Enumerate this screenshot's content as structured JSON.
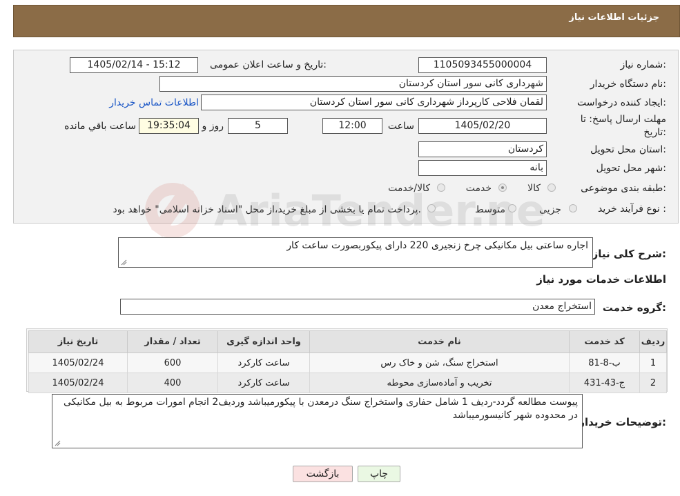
{
  "header": {
    "title": "جزئیات اطلاعات نیاز"
  },
  "form": {
    "need_number": {
      "label": "شماره نیاز:",
      "value": "1105093455000004"
    },
    "announce_datetime": {
      "label": "تاریخ و ساعت اعلان عمومی:",
      "value": "1405/02/14 - 15:12"
    },
    "buyer_org": {
      "label": "نام دستگاه خریدار:",
      "value": "شهرداری کانی سور استان کردستان"
    },
    "requester": {
      "label": "ایجاد کننده درخواست:",
      "value": "لقمان فلاحی کارپرداز شهرداری کانی سور استان کردستان"
    },
    "contact_link": "اطلاعات تماس خریدار",
    "deadline": {
      "label_line1": "مهلت ارسال پاسخ: تا",
      "label_line2": "تاریخ:",
      "date": "1405/02/20",
      "time_label": "ساعت",
      "time": "12:00",
      "days": "5",
      "days_label": "روز و",
      "remaining": "19:35:04",
      "remaining_label": "ساعت باقي مانده"
    },
    "province": {
      "label": "استان محل تحویل:",
      "value": "کردستان"
    },
    "city": {
      "label": "شهر محل تحویل:",
      "value": "بانه"
    },
    "category": {
      "label": "طبقه بندی موضوعی:",
      "options": [
        "کالا",
        "خدمت",
        "کالا/خدمت"
      ],
      "selected": "خدمت"
    },
    "purchase_type": {
      "label": "نوع فرآیند خرید :",
      "options": [
        "جزیی",
        "متوسط"
      ],
      "note": "پرداخت تمام یا بخشی از مبلغ خرید،از محل \"اسناد خزانه اسلامی\" خواهد بود."
    }
  },
  "watermark": "AriaTender.neT",
  "summary": {
    "label": "شرح کلی نیاز:",
    "value": "اجاره ساعتی بیل مکانیکی چرخ زنجیری 220 دارای پیکوربصورت ساعت کار"
  },
  "services_section": {
    "title": "اطلاعات خدمات مورد نیاز",
    "group_label": "گروه خدمت:",
    "group_value": "استخراج معدن"
  },
  "table": {
    "headers": [
      "ردیف",
      "کد خدمت",
      "نام خدمت",
      "واحد اندازه گیری",
      "تعداد / مقدار",
      "تاریخ نیاز"
    ],
    "rows": [
      [
        "1",
        "ب-8-81",
        "استخراج سنگ، شن و خاک رس",
        "ساعت کارکرد",
        "600",
        "1405/02/24"
      ],
      [
        "2",
        "ج-43-431",
        "تخریب و آماده‌سازی محوطه",
        "ساعت کارکرد",
        "400",
        "1405/02/24"
      ]
    ]
  },
  "buyer_notes": {
    "label": "توضیحات خریدار:",
    "value": "پیوست مطالعه گردد-ردیف 1 شامل حفاری واستخراج سنگ درمعدن با پیکورمیباشد  وردیف2 انجام امورات مربوط به بیل مکانیکی در محدوده شهر کانیسورمیباشد"
  },
  "buttons": {
    "print": "چاپ",
    "back": "بازگشت"
  }
}
